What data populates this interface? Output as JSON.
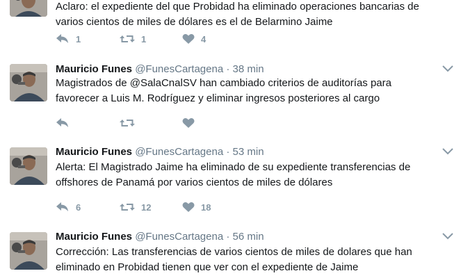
{
  "tweets": [
    {
      "name": "",
      "handle": "",
      "time": "",
      "text_lines": [
        "Aclaro: el expediente del que Probidad ha eliminado operaciones bancarias de",
        "varios cientos de miles de dólares es el de Belarmino Jaime"
      ],
      "replies": "1",
      "retweets": "1",
      "likes": "4"
    },
    {
      "name": "Mauricio Funes",
      "handle": "@FunesCartagena",
      "separator": "·",
      "time": "38 min",
      "text_lines": [
        "Magistrados de @SalaCnalSV han cambiado criterios de auditorías para",
        "favorecer a Luis M. Rodríguez y eliminar ingresos posteriores al cargo"
      ],
      "replies": "",
      "retweets": "",
      "likes": ""
    },
    {
      "name": "Mauricio Funes",
      "handle": "@FunesCartagena",
      "separator": "·",
      "time": "53 min",
      "text_lines": [
        "Alerta: El Magistrado Jaime ha eliminado de su expediente  transferencias de",
        "offshores de Panamá por varios cientos de miles de dólares"
      ],
      "replies": "6",
      "retweets": "12",
      "likes": "18"
    },
    {
      "name": "Mauricio Funes",
      "handle": "@FunesCartagena",
      "separator": "·",
      "time": "56 min",
      "text_lines": [
        "Corrección: Las transferencias de varios cientos de miles de dolares que han",
        "eliminado en Probidad tienen que ver con el expediente de Jaime"
      ],
      "replies": "",
      "retweets": "",
      "likes": ""
    }
  ],
  "colors": {
    "name": "#14171a",
    "meta": "#657786",
    "action_icon": "#8899a6",
    "divider": "#e1e8ed"
  },
  "icons": [
    "reply-icon",
    "retweet-icon",
    "like-icon",
    "chevron-down-icon"
  ]
}
